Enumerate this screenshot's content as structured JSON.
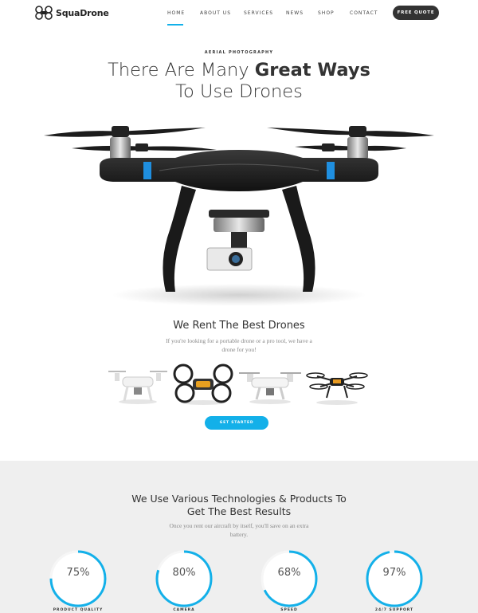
{
  "brand": {
    "name": "SquaDrone",
    "logo_icon": "quad-rotor-logo-icon"
  },
  "nav": {
    "items": [
      "HOME",
      "ABOUT US",
      "SERVICES",
      "NEWS",
      "SHOP",
      "CONTACT"
    ],
    "active": "HOME",
    "quote_button": "FREE QUOTE"
  },
  "hero": {
    "eyebrow": "AERIAL PHOTOGRAPHY",
    "title_plain": "There Are Many ",
    "title_bold": "Great Ways",
    "title_line2": "To Use Drones"
  },
  "rent": {
    "title": "We Rent The Best Drones",
    "text": "If you're looking for a portable drone or a pro tool, we have a drone for you!",
    "cta": "GET STARTED"
  },
  "tech": {
    "title_line1": "We Use Various Technologies & Products To",
    "title_line2": "Get The Best Results",
    "text": "Once you rent our aircraft by itself, you'll save on an extra battery.",
    "stats": [
      {
        "value": "75%",
        "label": "PRODUCT QUALITY",
        "percent": 75
      },
      {
        "value": "80%",
        "label": "CAMERA",
        "percent": 80
      },
      {
        "value": "68%",
        "label": "SPEED",
        "percent": 68
      },
      {
        "value": "97%",
        "label": "24/7 SUPPORT",
        "percent": 97
      }
    ]
  },
  "colors": {
    "accent": "#13b0e9",
    "dark": "#333333",
    "section_bg": "#efefef"
  }
}
